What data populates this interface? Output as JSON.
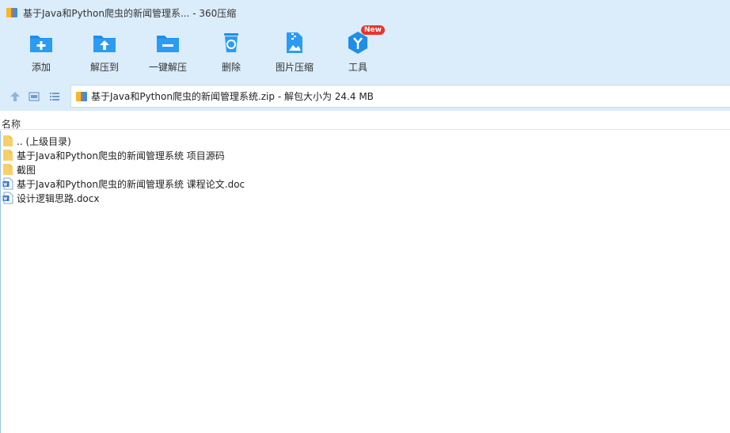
{
  "window": {
    "title": "基于Java和Python爬虫的新闻管理系... - 360压缩",
    "app_icon": "archive-icon"
  },
  "toolbar": {
    "buttons": [
      {
        "label": "添加",
        "icon": "add-folder-icon"
      },
      {
        "label": "解压到",
        "icon": "extract-to-folder-icon"
      },
      {
        "label": "一键解压",
        "icon": "one-click-extract-icon"
      },
      {
        "label": "删除",
        "icon": "recycle-bin-icon"
      },
      {
        "label": "图片压缩",
        "icon": "image-compress-icon"
      },
      {
        "label": "工具",
        "icon": "tools-icon",
        "badge": "New"
      }
    ]
  },
  "addressbar": {
    "nav_icons": [
      "up-arrow-icon",
      "detail-view-icon",
      "list-view-icon"
    ],
    "path": "基于Java和Python爬虫的新闻管理系统.zip - 解包大小为 24.4 MB"
  },
  "columns": {
    "name": "名称"
  },
  "files": [
    {
      "name": ".. (上级目录)",
      "icon": "folder-icon"
    },
    {
      "name": "基于Java和Python爬虫的新闻管理系统 项目源码",
      "icon": "folder-icon"
    },
    {
      "name": "截图",
      "icon": "folder-icon"
    },
    {
      "name": "基于Java和Python爬虫的新闻管理系统 课程论文.doc",
      "icon": "word-doc-icon"
    },
    {
      "name": "设计逻辑思路.docx",
      "icon": "word-doc-icon"
    }
  ],
  "colors": {
    "chrome_bg": "#dbecfb",
    "accent_blue": "#1e8ee8",
    "badge_red": "#e8352c"
  }
}
